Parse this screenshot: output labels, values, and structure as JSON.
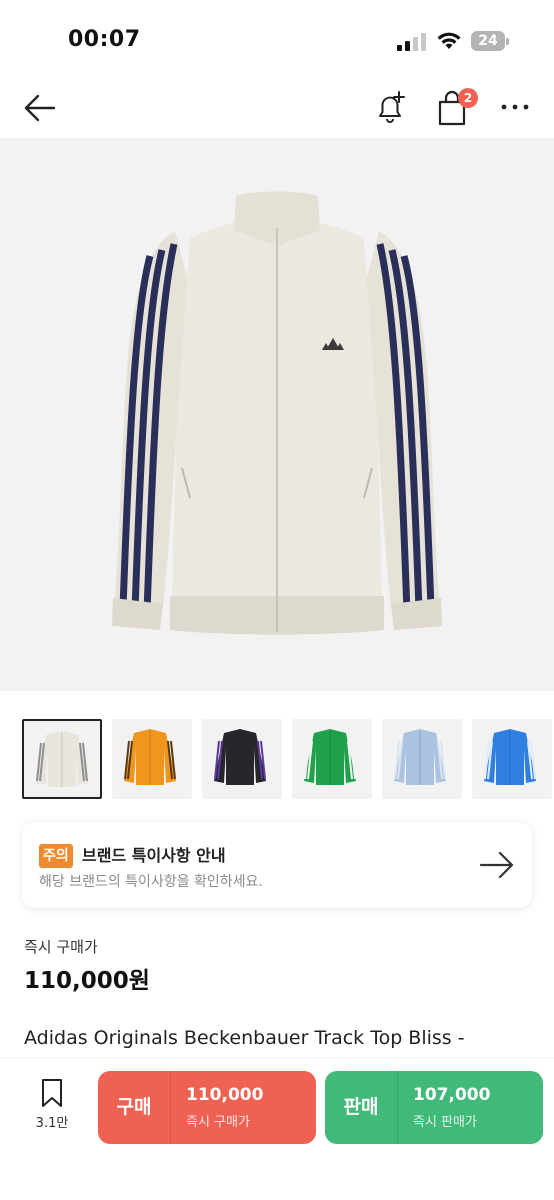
{
  "status": {
    "time": "00:07",
    "battery": "24"
  },
  "nav": {
    "cart_badge": "2"
  },
  "thumbnails": [
    {
      "color": "#e8e5dc",
      "stripe": "#8f8f8f"
    },
    {
      "color": "#f0961e",
      "stripe": "#5a3a12"
    },
    {
      "color": "#26262b",
      "stripe": "#5a3a9a"
    },
    {
      "color": "#1fa24a",
      "stripe": "#f2f2f2"
    },
    {
      "color": "#a9c3e0",
      "stripe": "#dce6f2"
    },
    {
      "color": "#2f7fe0",
      "stripe": "#dfeaf8"
    }
  ],
  "notice": {
    "badge": "주의",
    "title": "브랜드 특이사항 안내",
    "description": "해당 브랜드의 특이사항을 확인하세요."
  },
  "price": {
    "label": "즉시 구매가",
    "value": "110,000원"
  },
  "product": {
    "title": "Adidas Originals Beckenbauer Track Top Bliss -"
  },
  "bottom": {
    "bookmark_count": "3.1만",
    "buy": {
      "label": "구매",
      "price": "110,000",
      "sub": "즉시 구매가"
    },
    "sell": {
      "label": "판매",
      "price": "107,000",
      "sub": "즉시 판매가"
    }
  },
  "colors": {
    "buy": "#ef6253",
    "sell": "#41b979",
    "notice_badge": "#ef8a2f",
    "cart_badge": "#ef6253"
  }
}
